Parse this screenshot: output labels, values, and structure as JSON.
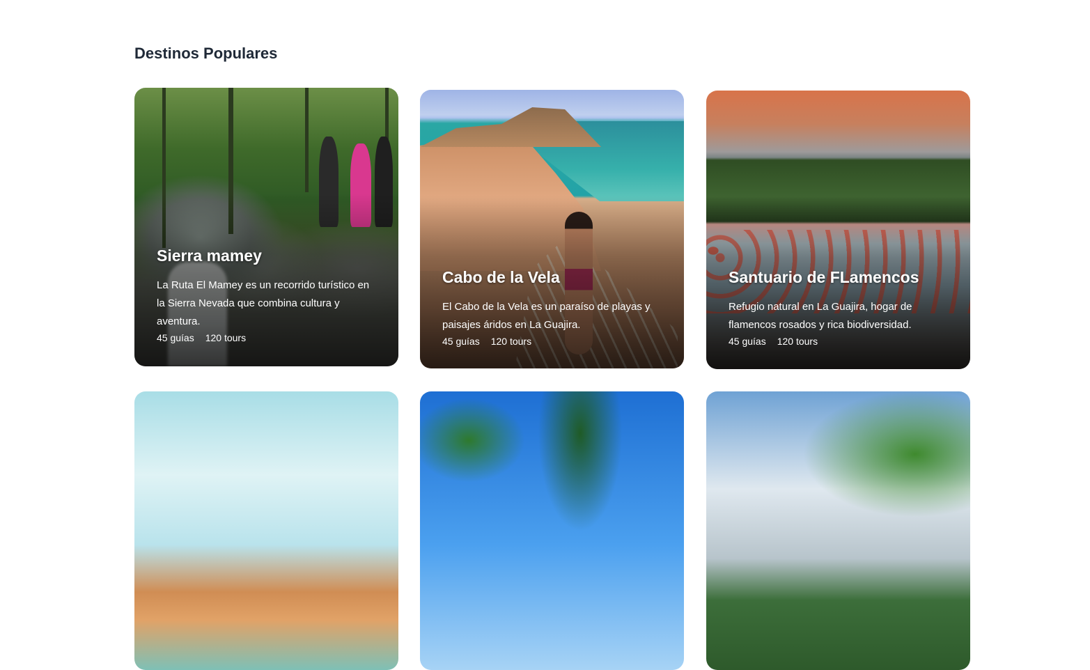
{
  "section": {
    "title": "Destinos Populares"
  },
  "destinations": [
    {
      "name": "Sierra mamey",
      "description": "La Ruta El Mamey es un recorrido turístico en la Sierra Nevada que combina cultura y aventura.",
      "guides": "45 guías",
      "tours": "120 tours"
    },
    {
      "name": "Cabo de la Vela",
      "description": "El Cabo de la Vela es un paraíso de playas y paisajes áridos en La Guajira.",
      "guides": "45 guías",
      "tours": "120 tours"
    },
    {
      "name": "Santuario de FLamencos",
      "description": "Refugio natural en La Guajira, hogar de flamencos rosados y rica biodiversidad.",
      "guides": "45 guías",
      "tours": "120 tours"
    }
  ],
  "colors": {
    "title": "#1f2937",
    "card_text": "#ffffff"
  }
}
